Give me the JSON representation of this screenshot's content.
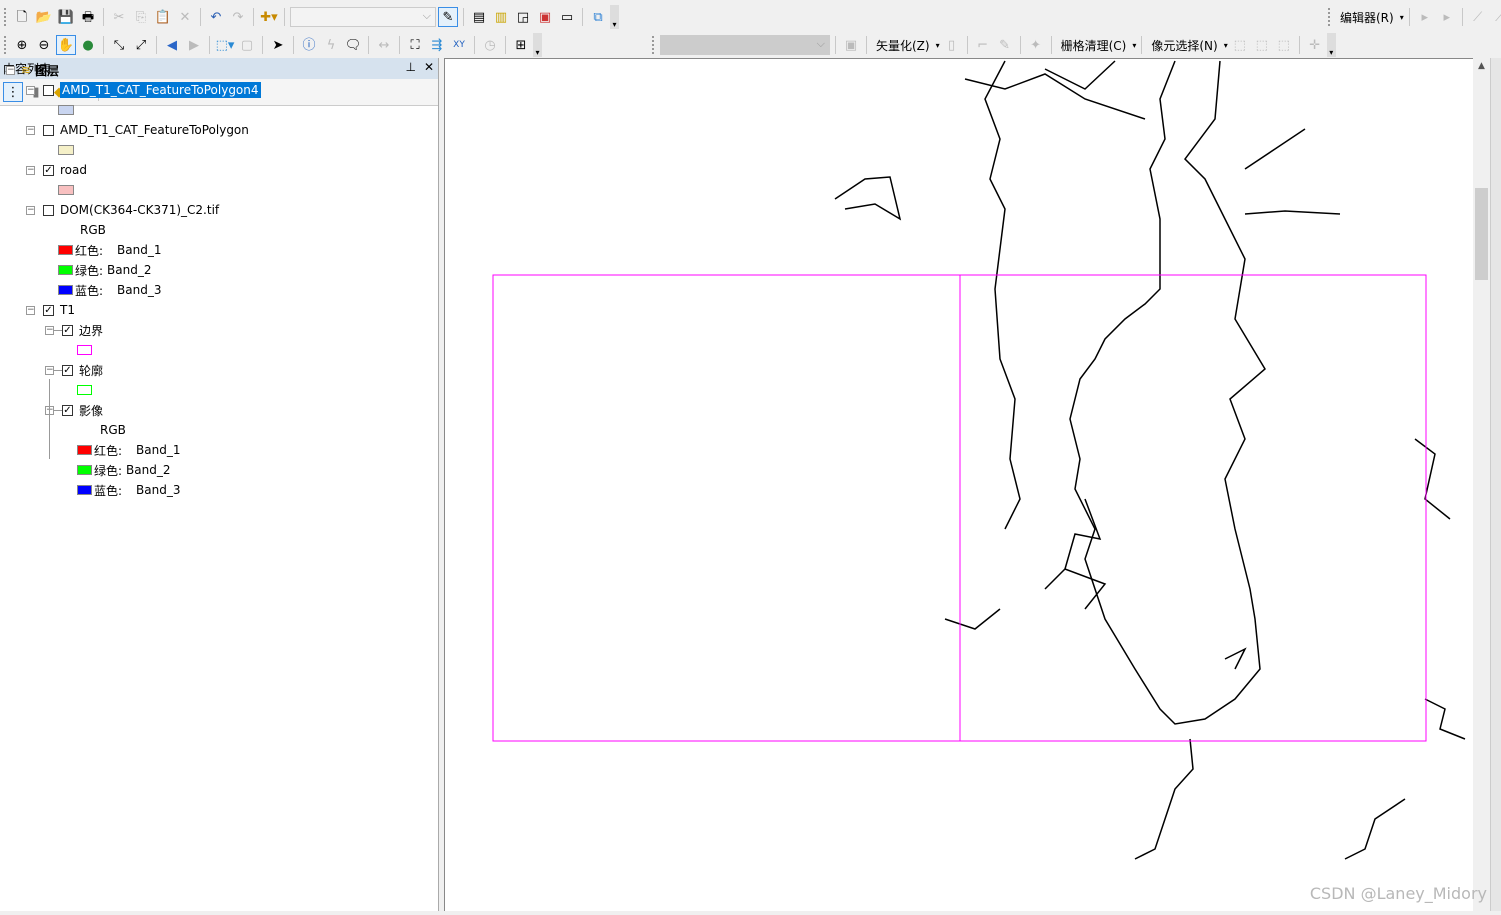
{
  "toolbar1": {
    "icons": [
      "new-document-icon",
      "open-icon",
      "save-icon",
      "print-icon",
      "cut-icon",
      "copy-icon",
      "paste-icon",
      "delete-icon",
      "undo-icon",
      "redo-icon",
      "add-data-icon"
    ],
    "icons2": [
      "editor-toolbar-icon",
      "table-of-contents-icon",
      "catalog-icon",
      "search-window-icon",
      "arctoolbox-icon",
      "python-icon",
      "model-builder-icon"
    ],
    "scale_value": "",
    "editor_menu": "编辑器(R)"
  },
  "toolbar2": {
    "icons": [
      "zoom-in-icon",
      "zoom-out-icon",
      "pan-icon",
      "full-extent-icon",
      "fixed-zoom-in-icon",
      "fixed-zoom-out-icon",
      "back-icon",
      "forward-icon",
      "select-features-icon",
      "clear-selection-icon",
      "select-elements-icon",
      "identify-icon",
      "hyperlink-icon",
      "html-popup-icon",
      "measure-icon",
      "find-icon",
      "find-route-icon",
      "go-to-xy-icon",
      "time-slider-icon",
      "magnifier-icon"
    ]
  },
  "raster_toolbar": {
    "layer_value": "",
    "vectorize_menu": "矢量化(Z)",
    "raster_cleanup_menu": "栅格清理(C)",
    "cell_selection_menu": "像元选择(N)"
  },
  "toc": {
    "title": "内容列表",
    "root": "图层",
    "layers": [
      {
        "name": "AMD_T1_CAT_FeatureToPolygon4",
        "checked": false,
        "selected": true,
        "swatch": "#c9d5f0"
      },
      {
        "name": "AMD_T1_CAT_FeatureToPolygon",
        "checked": false,
        "swatch": "#f5f0c8"
      },
      {
        "name": "road",
        "checked": true,
        "swatch": "#f8c0c0"
      },
      {
        "name": "DOM(CK364-CK371)_C2.tif",
        "checked": false,
        "rgb": "RGB",
        "bands": [
          {
            "label": "红色:",
            "band": "Band_1",
            "color": "#ff0000"
          },
          {
            "label": "绿色:",
            "band": "Band_2",
            "color": "#00ff00"
          },
          {
            "label": "蓝色:",
            "band": "Band_3",
            "color": "#0000ff"
          }
        ]
      },
      {
        "name": "T1",
        "checked": true,
        "children": [
          {
            "name": "边界",
            "checked": true,
            "outline": "#ff00ff"
          },
          {
            "name": "轮廓",
            "checked": true,
            "outline": "#00ff00"
          },
          {
            "name": "影像",
            "checked": true,
            "rgb": "RGB",
            "bands": [
              {
                "label": "红色:",
                "band": "Band_1",
                "color": "#ff0000"
              },
              {
                "label": "绿色:",
                "band": "Band_2",
                "color": "#00ff00"
              },
              {
                "label": "蓝色:",
                "band": "Band_3",
                "color": "#0000ff"
              }
            ]
          }
        ]
      }
    ]
  },
  "map": {
    "boundary_color": "#ff00ff",
    "road_color": "#000000"
  },
  "watermark": "CSDN @Laney_Midory"
}
